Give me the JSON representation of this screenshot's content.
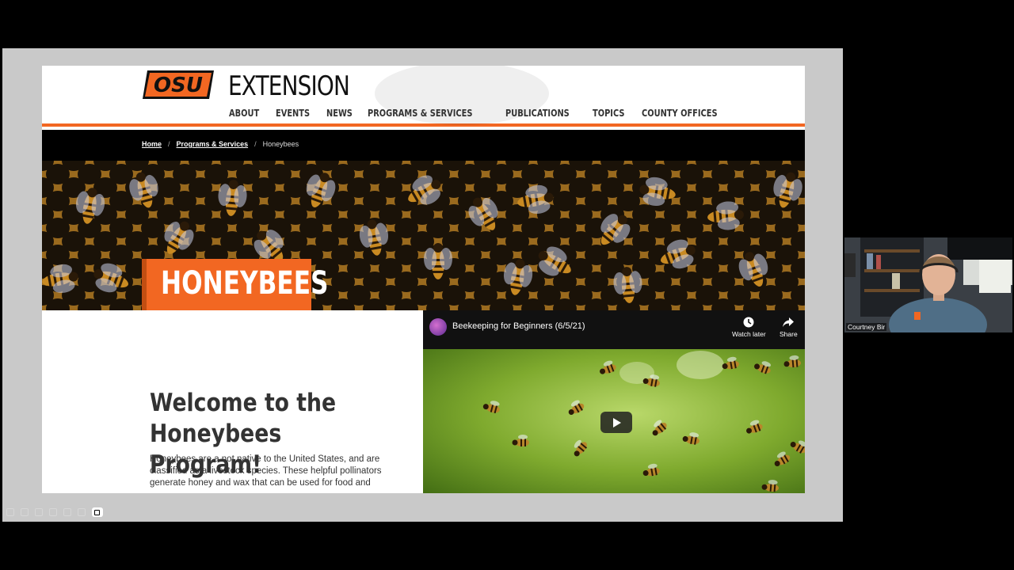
{
  "site": {
    "title": "EXTENSION",
    "nav": [
      "ABOUT",
      "EVENTS",
      "NEWS",
      "PROGRAMS & SERVICES",
      "PUBLICATIONS",
      "TOPICS",
      "COUNTY OFFICES"
    ]
  },
  "breadcrumb": {
    "home": "Home",
    "programs": "Programs & Services",
    "current": "Honeybees",
    "separator": "/"
  },
  "hero": {
    "title": "HONEYBEES"
  },
  "intro": {
    "heading": "Welcome to the Honeybees Program!",
    "body": "Honeybees are a not native to the United States, and are classified as a livestock species. These helpful pollinators generate honey and wax that can be used for food and"
  },
  "video": {
    "title": "Beekeeping for Beginners (6/5/21)",
    "watch_later": "Watch later",
    "share": "Share"
  },
  "webcam": {
    "name": "Courtney Bir"
  },
  "colors": {
    "brand_orange": "#f26722",
    "breadcrumb_bg": "#000000"
  }
}
